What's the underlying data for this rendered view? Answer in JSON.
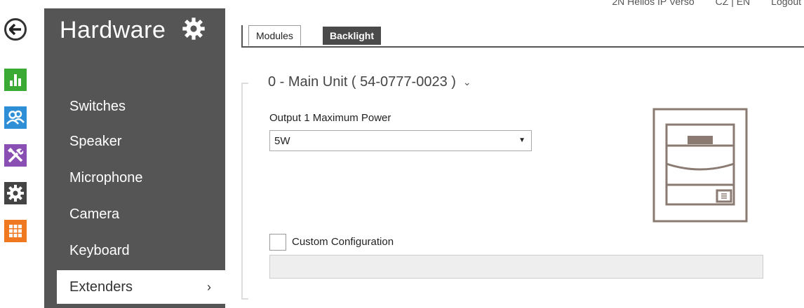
{
  "topbar": {
    "device_name": "2N Helios IP Verso",
    "languages": "CZ | EN",
    "logout": "Logout"
  },
  "left_strip": {
    "back_icon": "arrow-left-icon",
    "items": [
      {
        "icon": "status-chart-icon",
        "color": "#3aaa35"
      },
      {
        "icon": "users-icon",
        "color": "#2f8fd6"
      },
      {
        "icon": "tools-icon",
        "color": "#8a4fb3"
      },
      {
        "icon": "gear-icon",
        "color": "#444444"
      },
      {
        "icon": "grid-icon",
        "color": "#f07820"
      }
    ]
  },
  "sidebar": {
    "title": "Hardware",
    "title_icon": "gear-icon",
    "items": [
      {
        "label": "Switches"
      },
      {
        "label": "Speaker"
      },
      {
        "label": "Microphone"
      },
      {
        "label": "Camera"
      },
      {
        "label": "Keyboard"
      },
      {
        "label": "Extenders",
        "active": true,
        "chevron": "›"
      }
    ]
  },
  "tabs": [
    {
      "label": "Modules",
      "active": true
    },
    {
      "label": "Backlight",
      "active": false
    }
  ],
  "main": {
    "unit_title": "0 - Main Unit ( 54-0777-0023 )",
    "unit_chevron": "⌄",
    "output_label": "Output 1 Maximum Power",
    "output_value": "5W",
    "custom_config_label": "Custom Configuration",
    "custom_config_value": "",
    "custom_config_checked": false
  },
  "colors": {
    "sidebar_bg": "#555555",
    "device_outline": "#8a7a72"
  }
}
